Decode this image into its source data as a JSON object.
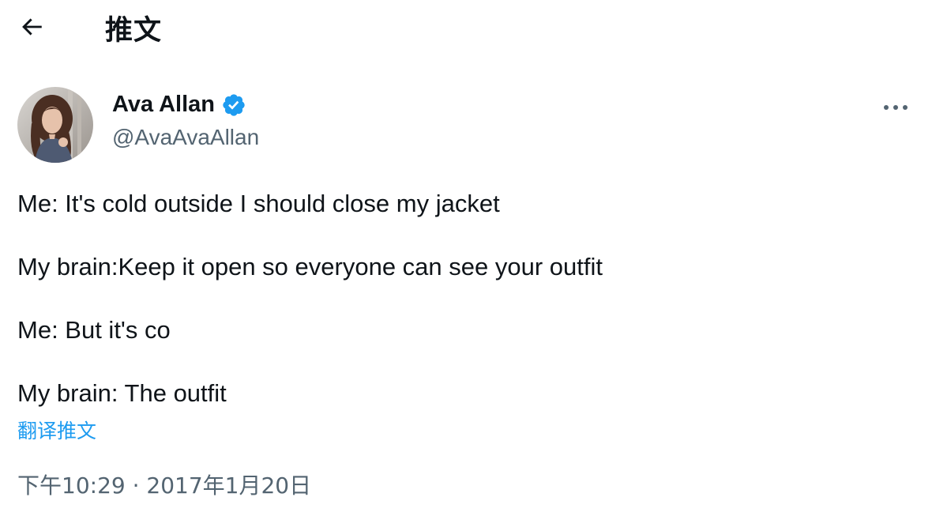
{
  "header": {
    "back_icon": "arrow-left-icon",
    "title": "推文"
  },
  "author": {
    "display_name": "Ava Allan",
    "handle": "@AvaAvaAllan",
    "verified_icon": "verified-badge-icon",
    "verified_color": "#1d9bf0"
  },
  "more_icon": "more-horizontal-icon",
  "tweet": {
    "lines": [
      "Me: It's cold outside I should close my jacket",
      "My brain:Keep it open so everyone can see your outfit",
      "Me: But it's co",
      "My brain: The outfit"
    ],
    "translate_label": "翻译推文",
    "timestamp": "下午10:29 · 2017年1月20日"
  },
  "colors": {
    "text": "#0f1419",
    "secondary": "#536471",
    "accent": "#1d9bf0"
  }
}
